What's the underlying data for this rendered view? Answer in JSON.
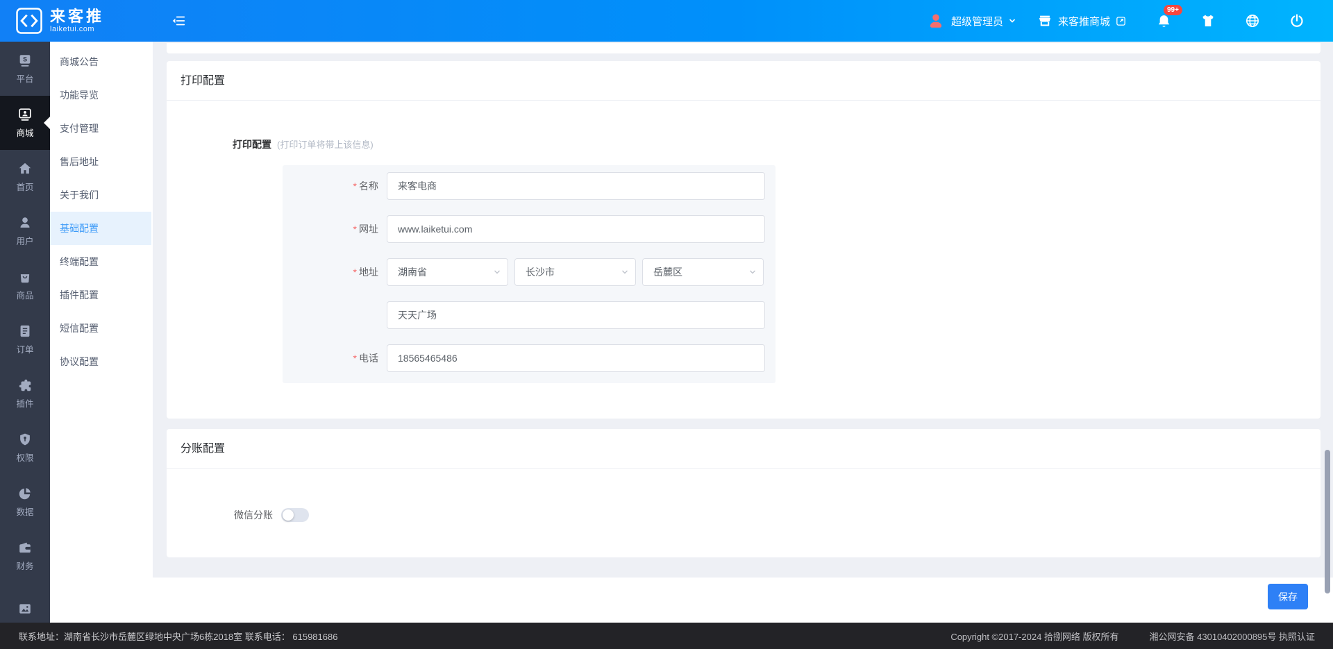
{
  "topbar": {
    "brand": {
      "name": "来客推",
      "domain": "laiketui.com"
    },
    "user": {
      "role": "超级管理员"
    },
    "shop_link": "来客推商城",
    "notification_badge": "99+"
  },
  "main_sidebar": {
    "items": [
      {
        "label": "平台",
        "icon": "platform-icon"
      },
      {
        "label": "商城",
        "icon": "mall-icon",
        "active": true
      },
      {
        "label": "首页",
        "icon": "home-icon"
      },
      {
        "label": "用户",
        "icon": "user-icon"
      },
      {
        "label": "商品",
        "icon": "goods-icon"
      },
      {
        "label": "订单",
        "icon": "order-icon"
      },
      {
        "label": "插件",
        "icon": "plugin-icon"
      },
      {
        "label": "权限",
        "icon": "permission-icon"
      },
      {
        "label": "数据",
        "icon": "data-icon"
      },
      {
        "label": "财务",
        "icon": "finance-icon"
      },
      {
        "label": "",
        "icon": "media-icon"
      }
    ]
  },
  "sub_sidebar": {
    "items": [
      {
        "label": "商城公告"
      },
      {
        "label": "功能导览"
      },
      {
        "label": "支付管理"
      },
      {
        "label": "售后地址"
      },
      {
        "label": "关于我们"
      },
      {
        "label": "基础配置",
        "active": true
      },
      {
        "label": "终端配置"
      },
      {
        "label": "插件配置"
      },
      {
        "label": "短信配置"
      },
      {
        "label": "协议配置"
      }
    ]
  },
  "content": {
    "required_mark": "*",
    "print_card": {
      "title": "打印配置",
      "form_label": "打印配置",
      "form_hint": "(打印订单将带上该信息)",
      "fields": [
        {
          "label": "名称",
          "value": "来客电商"
        },
        {
          "label": "网址",
          "value": "www.laiketui.com"
        },
        {
          "label": "地址",
          "values": [
            "湖南省",
            "长沙市",
            "岳麓区"
          ]
        },
        {
          "label": "",
          "value": "天天广场"
        },
        {
          "label": "电话",
          "value": "18565465486"
        }
      ]
    },
    "split_card": {
      "title": "分账配置",
      "toggle_label": "微信分账",
      "toggle_state": "off"
    },
    "save_label": "保存"
  },
  "footer": {
    "left": "联系地址：湖南省长沙市岳麓区绿地中央广场6栋2018室 联系电话： 615981686",
    "copyright": "Copyright ©2017-2024 拾捌网络 版权所有",
    "police": "湘公网安备 43010402000895号 执照认证"
  },
  "colors": {
    "topbar_gradient_start": "#1180f6",
    "topbar_gradient_end": "#00b4fe",
    "sidebar_dark": "#333a4a",
    "sidebar_dark_active": "#14171e",
    "menu_active_bg": "#e7f2fd",
    "menu_active_text": "#3d9bf8",
    "primary_button": "#2e80f6",
    "badge_red": "#f8473e",
    "avatar_red": "#f56e6e",
    "content_bg": "#eef0f5",
    "panel_bg": "#f5f7fa",
    "input_border": "#dcdfe6",
    "footer_bg": "#232327"
  }
}
